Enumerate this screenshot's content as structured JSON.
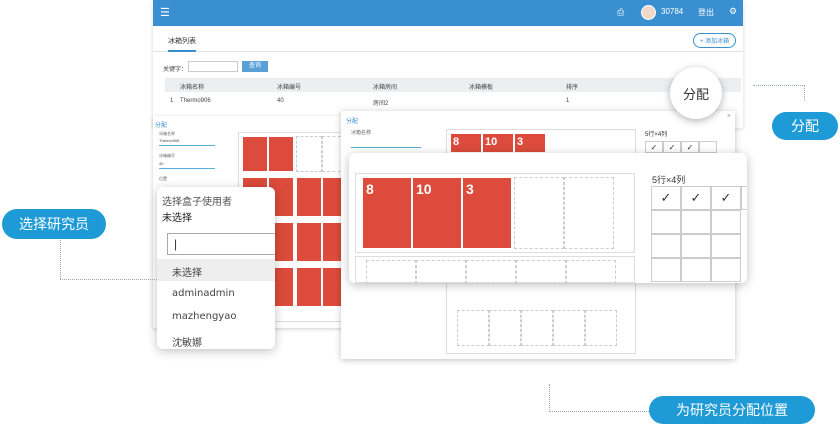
{
  "app": {
    "menu_icon": "menu-icon",
    "user_id": "30784",
    "logout": "登出",
    "print_icon": "print-icon",
    "settings_icon": "gear-icon"
  },
  "tab": {
    "label": "冰箱列表"
  },
  "add_button": "+ 添加冰箱",
  "search": {
    "label": "关键字：",
    "placeholder": "",
    "button": "查询"
  },
  "table": {
    "headers": [
      "冰箱名称",
      "冰箱编号",
      "冰箱房间",
      "冰箱模板",
      "排序"
    ],
    "rows": [
      {
        "index": "1",
        "name": "Thermo906",
        "code": "40",
        "room": "房间2",
        "template": "",
        "order": "1"
      }
    ]
  },
  "dialog_back": {
    "title": "分配",
    "field1_label": "冰箱名称",
    "field1_value": "Thermo906",
    "field2_label": "冰箱编号",
    "field2_value": "40",
    "field3_label": "位置"
  },
  "dropdown": {
    "label": "选择盒子使用者",
    "current": "未选择",
    "search_value": "",
    "options": [
      "未选择",
      "adminadmin",
      "mazhengyao",
      "沈敏娜"
    ]
  },
  "dialog_mid": {
    "title": "分配",
    "field1_label": "冰箱名称",
    "grid_label": "5行×4列",
    "red_labels": [
      "8",
      "10",
      "3"
    ]
  },
  "zoom": {
    "red_labels": [
      "8",
      "10",
      "3"
    ],
    "grid_label": "5行×4列",
    "checks": [
      "✓",
      "✓",
      "✓"
    ]
  },
  "callout": {
    "label": "分配"
  },
  "pills": {
    "assign": "分配",
    "choose": "选择研究员",
    "allocate": "为研究员分配位置"
  }
}
